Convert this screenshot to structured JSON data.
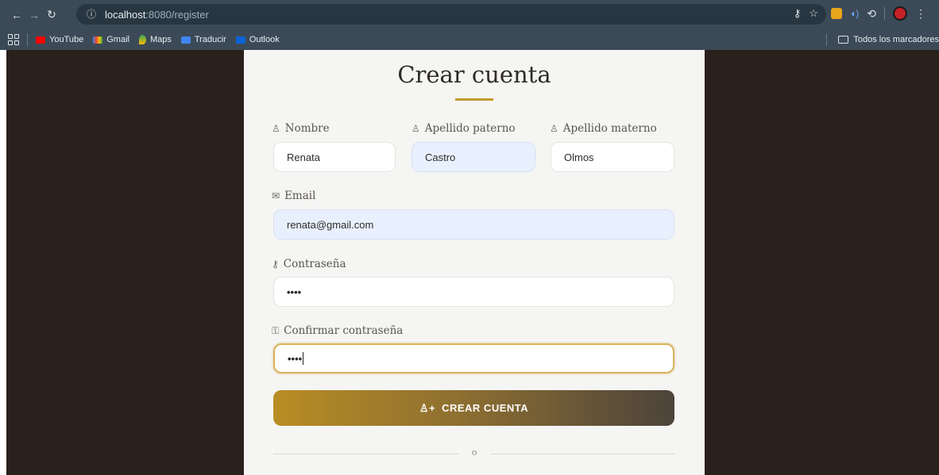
{
  "browser": {
    "url_host": "localhost",
    "url_path": ":8080/register",
    "bookmarks": [
      {
        "label": "YouTube",
        "color": "#ff0000"
      },
      {
        "label": "Gmail",
        "color": "#ea4335"
      },
      {
        "label": "Maps",
        "color": "#34a853"
      },
      {
        "label": "Traducir",
        "color": "#4285f4"
      },
      {
        "label": "Outlook",
        "color": "#0a64d6"
      }
    ],
    "bookmarks_folder": "Todos los marcadores"
  },
  "form": {
    "title": "Crear cuenta",
    "nombre_label": "Nombre",
    "nombre_value": "Renata",
    "apellido_paterno_label": "Apellido paterno",
    "apellido_paterno_value": "Castro",
    "apellido_materno_label": "Apellido materno",
    "apellido_materno_value": "Olmos",
    "email_label": "Email",
    "email_value": "renata@gmail.com",
    "password_label": "Contraseña",
    "password_value": "••••",
    "confirm_label": "Confirmar contraseña",
    "confirm_value": "••••",
    "submit_label": "CREAR CUENTA",
    "divider_text": "o"
  },
  "colors": {
    "accent": "#c59a2b",
    "background": "#2b211c",
    "card": "#f5f5f4"
  }
}
